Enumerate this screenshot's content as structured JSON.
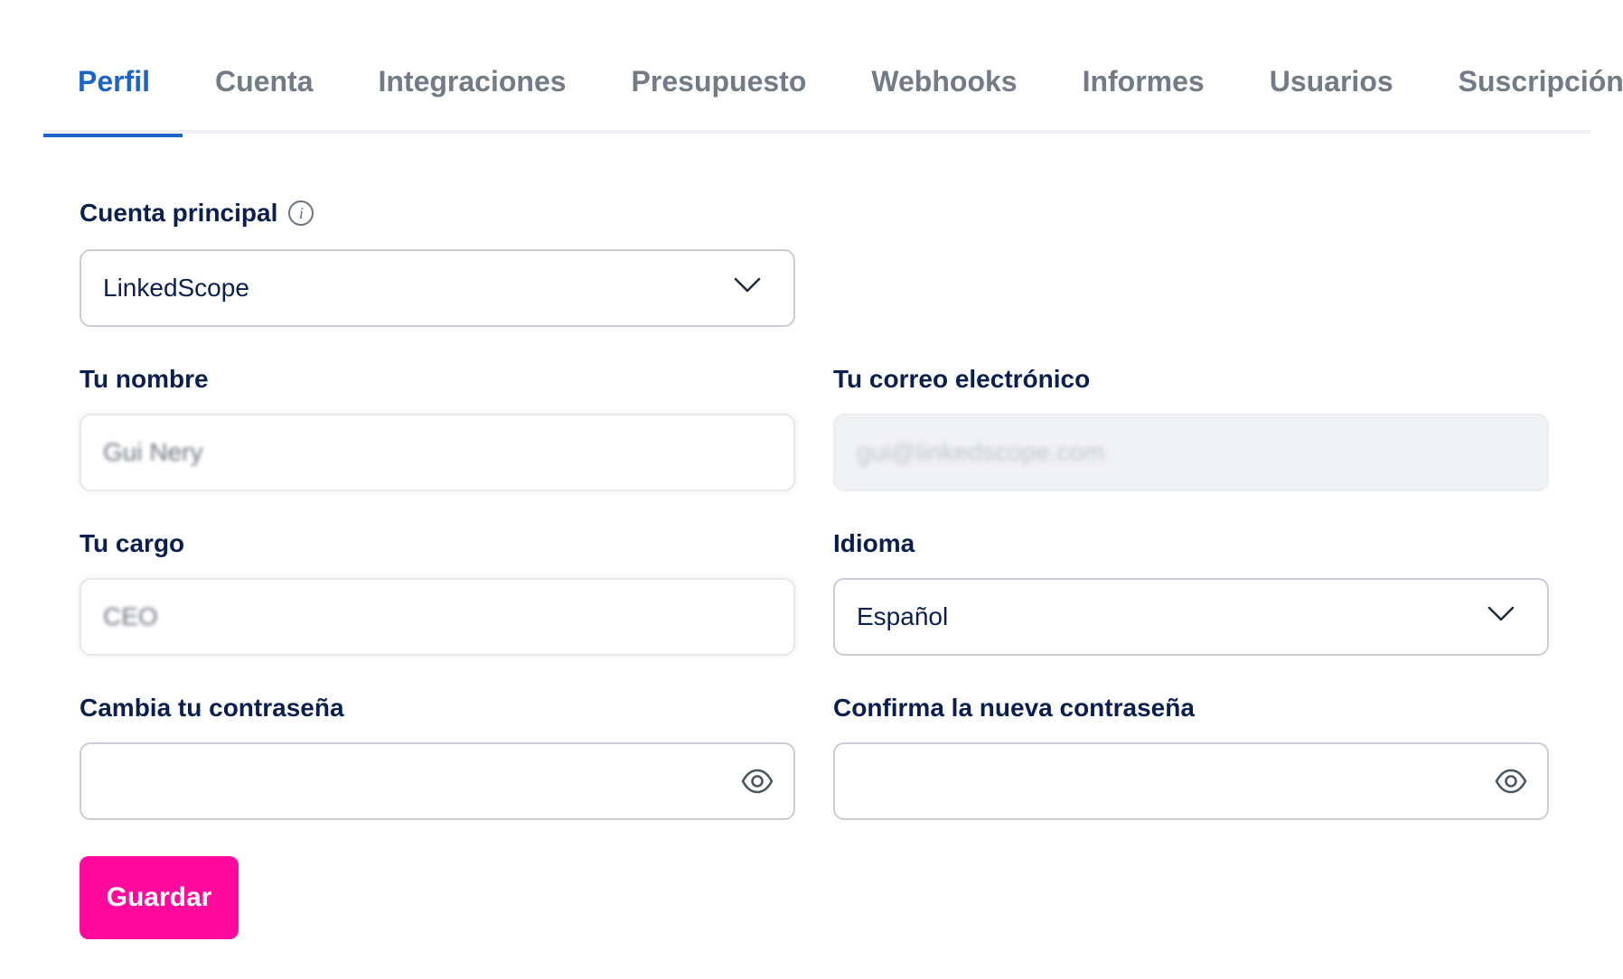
{
  "tabs": [
    {
      "label": "Perfil",
      "active": true
    },
    {
      "label": "Cuenta",
      "active": false
    },
    {
      "label": "Integraciones",
      "active": false
    },
    {
      "label": "Presupuesto",
      "active": false
    },
    {
      "label": "Webhooks",
      "active": false
    },
    {
      "label": "Informes",
      "active": false
    },
    {
      "label": "Usuarios",
      "active": false
    },
    {
      "label": "Suscripción",
      "active": false
    }
  ],
  "form": {
    "main_account": {
      "label": "Cuenta principal",
      "value": "LinkedScope",
      "info_icon": "info-icon"
    },
    "name": {
      "label": "Tu nombre",
      "value": "Gui Nery"
    },
    "email": {
      "label": "Tu correo electrónico",
      "value": "gui@linkedscope.com"
    },
    "role": {
      "label": "Tu cargo",
      "value": "CEO"
    },
    "language": {
      "label": "Idioma",
      "value": "Español"
    },
    "password": {
      "label": "Cambia tu contraseña",
      "value": "",
      "icon": "eye-icon"
    },
    "confirm_password": {
      "label": "Confirma la nueva contraseña",
      "value": "",
      "icon": "eye-icon"
    },
    "save_label": "Guardar"
  },
  "colors": {
    "accent": "#1c64c6",
    "heading": "#0b1f4f",
    "button": "#ff0a9c"
  }
}
